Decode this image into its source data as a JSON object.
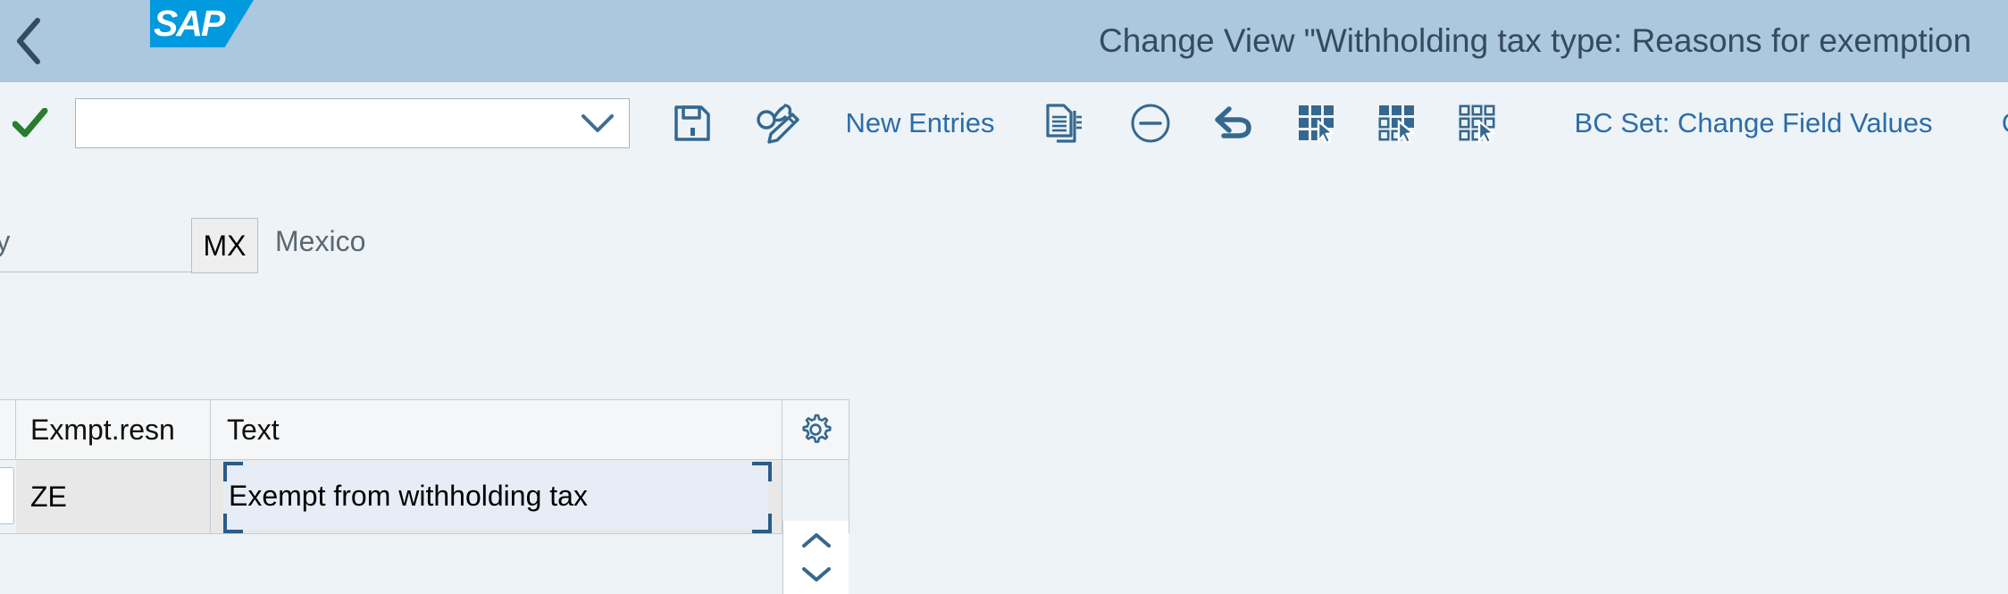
{
  "shell": {
    "back_icon": "chevron-left-icon",
    "logo_text": "SAP",
    "title": "Change View \"Withholding tax type: Reasons for exemption"
  },
  "toolbar": {
    "confirm_icon": "green-checkmark-icon",
    "command_field_value": "",
    "command_field_placeholder": "",
    "dropdown_icon": "chevron-down-icon",
    "items": [
      {
        "name": "save-button",
        "icon": "floppy-disk-save-icon",
        "label": ""
      },
      {
        "name": "display-change-button",
        "icon": "glasses-pencil-icon",
        "label": ""
      },
      {
        "name": "new-entries-button",
        "icon": "",
        "label": "New Entries"
      },
      {
        "name": "copy-as-button",
        "icon": "copy-documents-icon",
        "label": ""
      },
      {
        "name": "delete-button",
        "icon": "minus-circle-icon",
        "label": ""
      },
      {
        "name": "undo-button",
        "icon": "undo-arrow-icon",
        "label": ""
      },
      {
        "name": "select-all-button",
        "icon": "grid-select-all-icon",
        "label": ""
      },
      {
        "name": "select-block-button",
        "icon": "grid-select-block-icon",
        "label": ""
      },
      {
        "name": "deselect-all-button",
        "icon": "grid-deselect-all-icon",
        "label": ""
      },
      {
        "name": "bc-set-change-field-values-button",
        "icon": "",
        "label": "BC Set: Change Field Values"
      }
    ],
    "overflow_label": "C"
  },
  "form": {
    "country_label": "ntry",
    "country_code": "MX",
    "country_name": "Mexico"
  },
  "table": {
    "columns": [
      "Exmpt.resn",
      "Text"
    ],
    "settings_icon": "gear-icon",
    "scroll_up_icon": "chevron-up-icon",
    "scroll_down_icon": "chevron-down-icon",
    "rows": [
      {
        "code": "ZE",
        "text": "Exempt from withholding tax"
      }
    ]
  },
  "colors": {
    "shell_bg": "#abc8de",
    "logo_bg": "#019ade",
    "page_bg": "#eef3f7",
    "accent_blue": "#2b6da8",
    "title_text": "#354a5f",
    "confirm_green": "#2a7d2e",
    "focus_border": "#2b5b86"
  }
}
